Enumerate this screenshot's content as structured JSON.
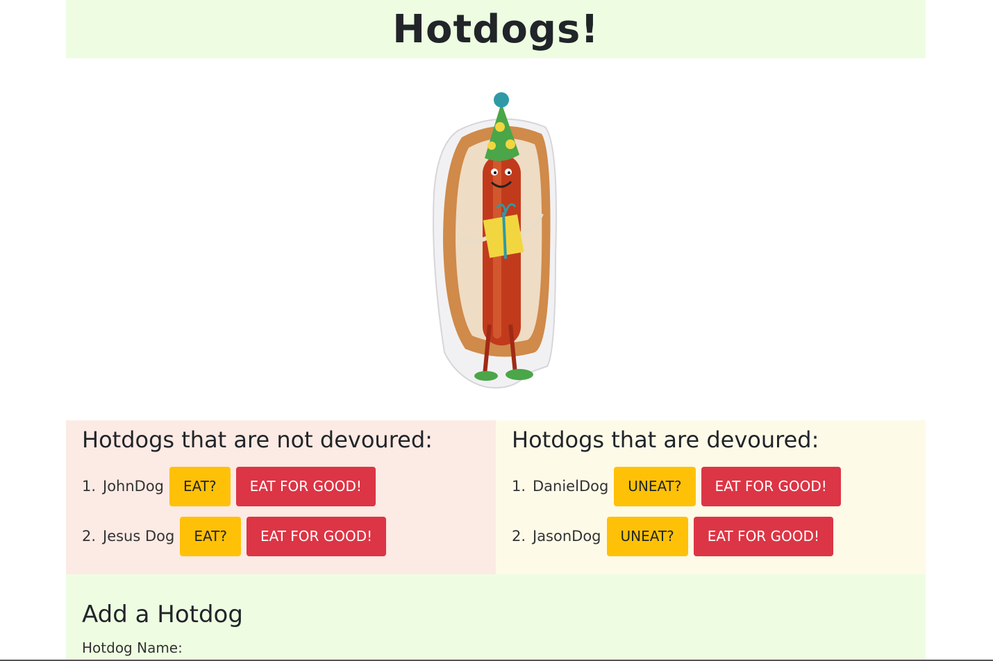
{
  "header": {
    "title": "Hotdogs!"
  },
  "not_devoured": {
    "heading": "Hotdogs that are not devoured:",
    "items": [
      {
        "num": "1.",
        "name": "JohnDog",
        "primary": "EAT?",
        "danger": "EAT FOR GOOD!"
      },
      {
        "num": "2.",
        "name": "Jesus Dog",
        "primary": "EAT?",
        "danger": "EAT FOR GOOD!"
      }
    ]
  },
  "devoured": {
    "heading": "Hotdogs that are devoured:",
    "items": [
      {
        "num": "1.",
        "name": "DanielDog",
        "primary": "UNEAT?",
        "danger": "EAT FOR GOOD!"
      },
      {
        "num": "2.",
        "name": "JasonDog",
        "primary": "UNEAT?",
        "danger": "EAT FOR GOOD!"
      }
    ]
  },
  "add_form": {
    "heading": "Add a Hotdog",
    "name_label": "Hotdog Name:"
  },
  "colors": {
    "header_bg": "#eefde2",
    "left_bg": "#fceae4",
    "right_bg": "#fefae8",
    "warning": "#ffc107",
    "danger": "#dc3545"
  },
  "hero_image": {
    "icon": "hotdog-character-illustration"
  }
}
